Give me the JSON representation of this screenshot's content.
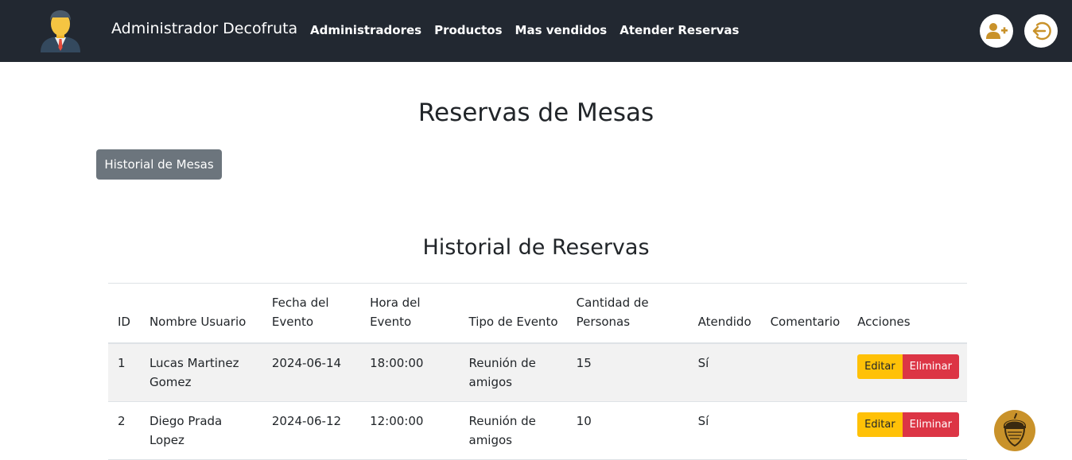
{
  "navbar": {
    "brand": "Administrador Decofruta",
    "links": [
      "Administradores",
      "Productos",
      "Mas vendidos",
      "Atender Reservas"
    ],
    "accent_color": "#c9922a",
    "background_color": "#222831"
  },
  "main": {
    "title": "Reservas de Mesas",
    "historial_mesas_button": "Historial de Mesas",
    "section_title": "Historial de Reservas"
  },
  "table": {
    "headers": [
      "ID",
      "Nombre Usuario",
      "Fecha del Evento",
      "Hora del Evento",
      "Tipo de Evento",
      "Cantidad de Personas",
      "Atendido",
      "Comentario",
      "Acciones"
    ],
    "rows": [
      {
        "id": "1",
        "nombre": "Lucas Martinez Gomez",
        "fecha": "2024-06-14",
        "hora": "18:00:00",
        "tipo": "Reunión de amigos",
        "cantidad": "15",
        "atendido": "Sí",
        "comentario": ""
      },
      {
        "id": "2",
        "nombre": "Diego Prada Lopez",
        "fecha": "2024-06-12",
        "hora": "12:00:00",
        "tipo": "Reunión de amigos",
        "cantidad": "10",
        "atendido": "Sí",
        "comentario": ""
      }
    ],
    "edit_label": "Editar",
    "delete_label": "Eliminar"
  },
  "icons": {
    "avatar": "admin-avatar-icon",
    "add_user": "user-plus-icon",
    "logout": "logout-icon",
    "floating": "acorn-icon"
  }
}
